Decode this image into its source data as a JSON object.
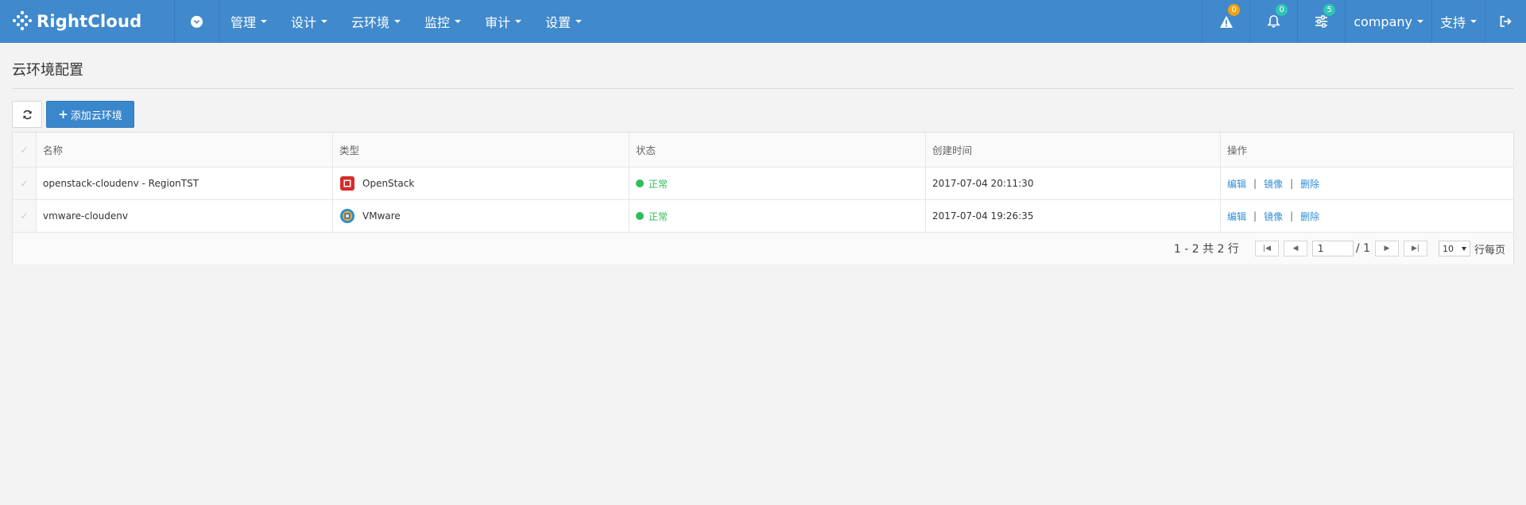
{
  "brand": {
    "name": "RightCloud"
  },
  "nav": {
    "menus": [
      {
        "label": "管理"
      },
      {
        "label": "设计"
      },
      {
        "label": "云环境"
      },
      {
        "label": "监控"
      },
      {
        "label": "审计"
      },
      {
        "label": "设置"
      }
    ],
    "alerts_count": "0",
    "notifications_count": "0",
    "tasks_count": "5",
    "company_label": "company",
    "support_label": "支持",
    "icons": [
      "chevron-down-circle-icon",
      "warning-icon",
      "bell-icon",
      "sliders-icon",
      "logout-icon"
    ]
  },
  "page": {
    "title": "云环境配置"
  },
  "toolbar": {
    "add_label": "添加云环境"
  },
  "table": {
    "headers": {
      "name": "名称",
      "type": "类型",
      "status": "状态",
      "created": "创建时间",
      "ops": "操作"
    },
    "rows": [
      {
        "name": "openstack-cloudenv - RegionTST",
        "type": "OpenStack",
        "status": "正常",
        "created": "2017-07-04 20:11:30",
        "edit": "编辑",
        "image": "镜像",
        "delete": "删除",
        "sep": "|"
      },
      {
        "name": "vmware-cloudenv",
        "type": "VMware",
        "status": "正常",
        "created": "2017-07-04 19:26:35",
        "edit": "编辑",
        "image": "镜像",
        "delete": "删除",
        "sep": "|"
      }
    ]
  },
  "pagination": {
    "info": "1 - 2 共 2 行",
    "page_value": "1",
    "total_pages": "/ 1",
    "page_size": "10",
    "per_page_label": "行每页"
  },
  "colors": {
    "navbar": "#4089cc",
    "accent": "#3a87cc",
    "status_ok": "#2dbd5a",
    "link": "#2f8ed6",
    "badge_orange": "#f0a50f",
    "badge_teal": "#2ec7b6"
  }
}
